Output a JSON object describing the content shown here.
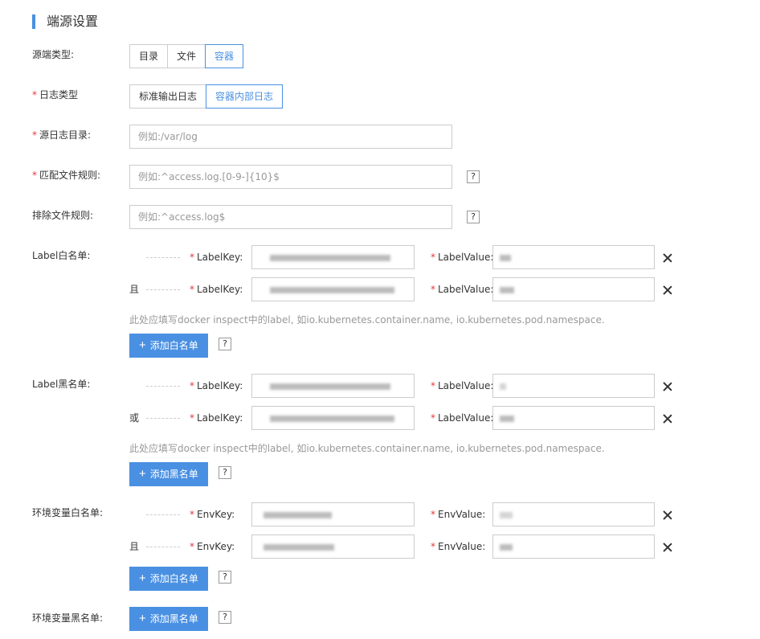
{
  "section": {
    "title": "端源设置"
  },
  "source_type": {
    "label": "源端类型:",
    "options": [
      "目录",
      "文件",
      "容器"
    ],
    "selected": "容器"
  },
  "log_type": {
    "required": "*",
    "label": "日志类型",
    "options": [
      "标准输出日志",
      "容器内部日志"
    ],
    "selected": "容器内部日志"
  },
  "source_dir": {
    "required": "*",
    "label": "源日志目录:",
    "placeholder": "例如:/var/log"
  },
  "match_rule": {
    "required": "*",
    "label": "匹配文件规则:",
    "placeholder": "例如:^access.log.[0-9-]{10}$",
    "help": "?"
  },
  "exclude_rule": {
    "label": "排除文件规则:",
    "placeholder": "例如:^access.log$",
    "help": "?"
  },
  "label_whitelist": {
    "label": "Label白名单:",
    "connector": "且",
    "key_label": "LabelKey:",
    "value_label": "LabelValue:",
    "required": "*",
    "hint": "此处应填写docker inspect中的label, 如io.kubernetes.container.name, io.kubernetes.pod.namespace.",
    "add_button": "添加白名单",
    "help": "?"
  },
  "label_blacklist": {
    "label": "Label黑名单:",
    "connector": "或",
    "key_label": "LabelKey:",
    "value_label": "LabelValue:",
    "required": "*",
    "hint": "此处应填写docker inspect中的label, 如io.kubernetes.container.name, io.kubernetes.pod.namespace.",
    "add_button": "添加黑名单",
    "help": "?"
  },
  "env_whitelist": {
    "label": "环境变量白名单:",
    "connector": "且",
    "key_label": "EnvKey:",
    "value_label": "EnvValue:",
    "required": "*",
    "add_button": "添加白名单",
    "help": "?"
  },
  "env_blacklist": {
    "label": "环境变量黑名单:",
    "add_button": "添加黑名单",
    "help": "?"
  },
  "icons": {
    "plus": "+",
    "close": "close-icon"
  },
  "colors": {
    "accent": "#4a90e2",
    "required": "#e4393c",
    "hint": "#999999"
  }
}
